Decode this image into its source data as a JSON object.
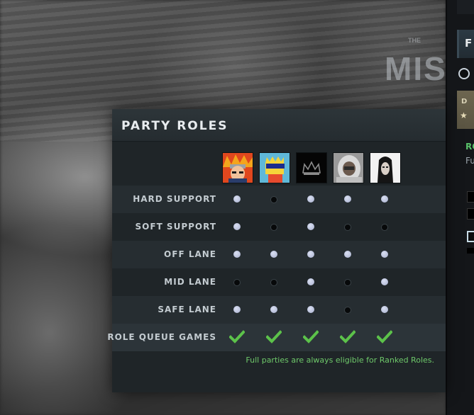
{
  "background": {
    "watermark_text": "MIS",
    "watermark_small": "THE"
  },
  "side_panel": {
    "tab_letter": "F",
    "gold_letter": "D",
    "gold_star": "★",
    "green_text": "RO",
    "grey_text": "Fu"
  },
  "panel": {
    "title": "PARTY ROLES",
    "avatars": [
      {
        "name": "player-1-avatar",
        "colors": [
          "#e0471e",
          "#f4a51c"
        ]
      },
      {
        "name": "player-2-avatar",
        "colors": [
          "#5fb8d8",
          "#f5d43a"
        ]
      },
      {
        "name": "player-3-avatar",
        "colors": [
          "#050505",
          "#8c8c8c"
        ]
      },
      {
        "name": "player-4-avatar",
        "colors": [
          "#d9d9d9",
          "#2b2b2b"
        ]
      },
      {
        "name": "player-5-avatar",
        "colors": [
          "#f2f2f2",
          "#151515"
        ]
      }
    ],
    "roles": [
      {
        "label": "HARD SUPPORT",
        "eligible": [
          true,
          false,
          true,
          true,
          true
        ]
      },
      {
        "label": "SOFT SUPPORT",
        "eligible": [
          true,
          false,
          true,
          false,
          false
        ]
      },
      {
        "label": "OFF LANE",
        "eligible": [
          true,
          true,
          true,
          true,
          true
        ]
      },
      {
        "label": "MID LANE",
        "eligible": [
          false,
          false,
          true,
          false,
          true
        ]
      },
      {
        "label": "SAFE LANE",
        "eligible": [
          true,
          true,
          true,
          false,
          true
        ]
      }
    ],
    "role_queue": {
      "label": "ROLE QUEUE GAMES",
      "eligible": [
        true,
        true,
        true,
        true,
        true
      ]
    },
    "note": "Full parties are always eligible for Ranked Roles.",
    "colors": {
      "check": "#5cc24a",
      "note": "#6ec86a",
      "dot_on": "#c4cbe6",
      "dot_off": "#07090a"
    }
  }
}
